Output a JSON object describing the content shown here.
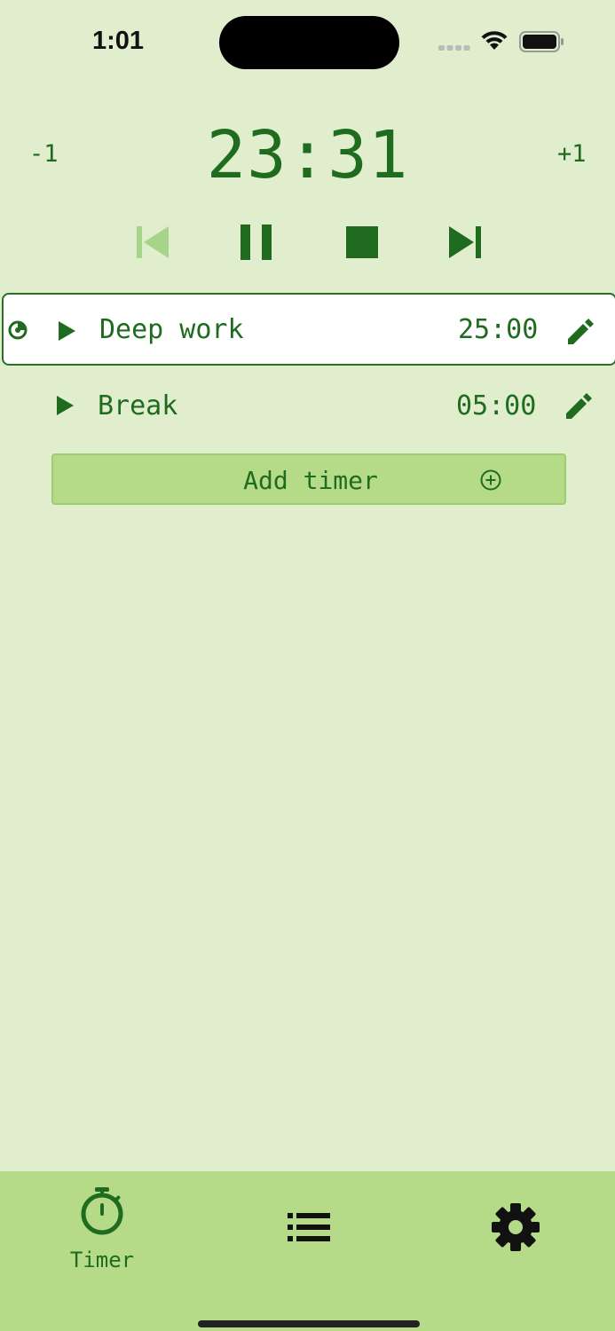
{
  "status_bar": {
    "time": "1:01",
    "icons": [
      "signal-dots-icon",
      "wifi-icon",
      "battery-icon"
    ]
  },
  "header": {
    "minus_label": "-1",
    "plus_label": "+1",
    "current_time": "23:31"
  },
  "controls": {
    "icons": [
      "skip-back-icon",
      "pause-icon",
      "stop-icon",
      "skip-forward-icon"
    ]
  },
  "timers": [
    {
      "name": "Deep work",
      "duration": "25:00",
      "active": true
    },
    {
      "name": "Break",
      "duration": "05:00",
      "active": false
    }
  ],
  "add_button": {
    "label": "Add timer",
    "icon": "plus-circle-icon"
  },
  "tab_bar": {
    "tabs": [
      {
        "label": "Timer",
        "icon": "stopwatch-icon",
        "selected": true
      },
      {
        "label": "",
        "icon": "list-icon",
        "selected": false
      },
      {
        "label": "",
        "icon": "gear-icon",
        "selected": false
      }
    ]
  },
  "colors": {
    "background": "#e0eecd",
    "accent": "#1f6b1f",
    "accent_light": "#b5db88",
    "active_row_bg": "#ffffff",
    "disabled_icon": "#a6d48a"
  }
}
